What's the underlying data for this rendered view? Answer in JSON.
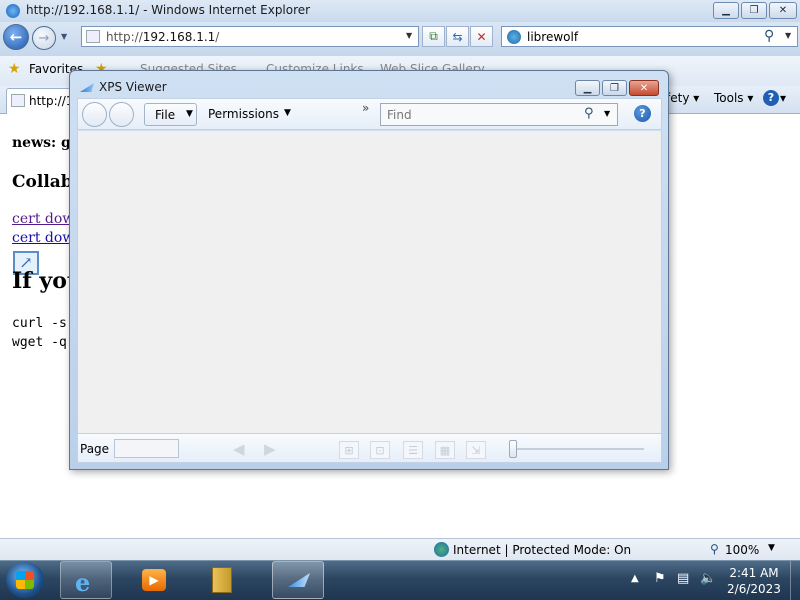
{
  "ie": {
    "title": "http://192.168.1.1/ - Windows Internet Explorer",
    "address_prefix": "http://",
    "address_host": "192.168.1.1",
    "address_suffix": "/",
    "search_value": "librewolf",
    "favorites_label": "Favorites",
    "suggested_sites": "Suggested Sites",
    "customize_links": "Customize Links",
    "web_slice_gallery": "Web Slice Gallery",
    "tab_label": "http://1",
    "safety_label": "fety",
    "tools_label": "Tools",
    "help_label": "?"
  },
  "page": {
    "news_heading": "news: go",
    "collab_heading": "Collab",
    "cert_link_1": "cert down",
    "cert_link_2": "cert down",
    "big_heading": "If you",
    "code_line_1": "curl -s",
    "code_line_2": "wget -q"
  },
  "status": {
    "zone_text": "Internet | Protected Mode: On",
    "zoom": "100%"
  },
  "xps": {
    "title": "XPS Viewer",
    "file_menu": "File",
    "permissions_menu": "Permissions",
    "overflow": "»",
    "find_placeholder": "Find",
    "page_label": "Page",
    "help": "?"
  },
  "taskbar": {
    "time": "2:41 AM",
    "date": "2/6/2023"
  }
}
